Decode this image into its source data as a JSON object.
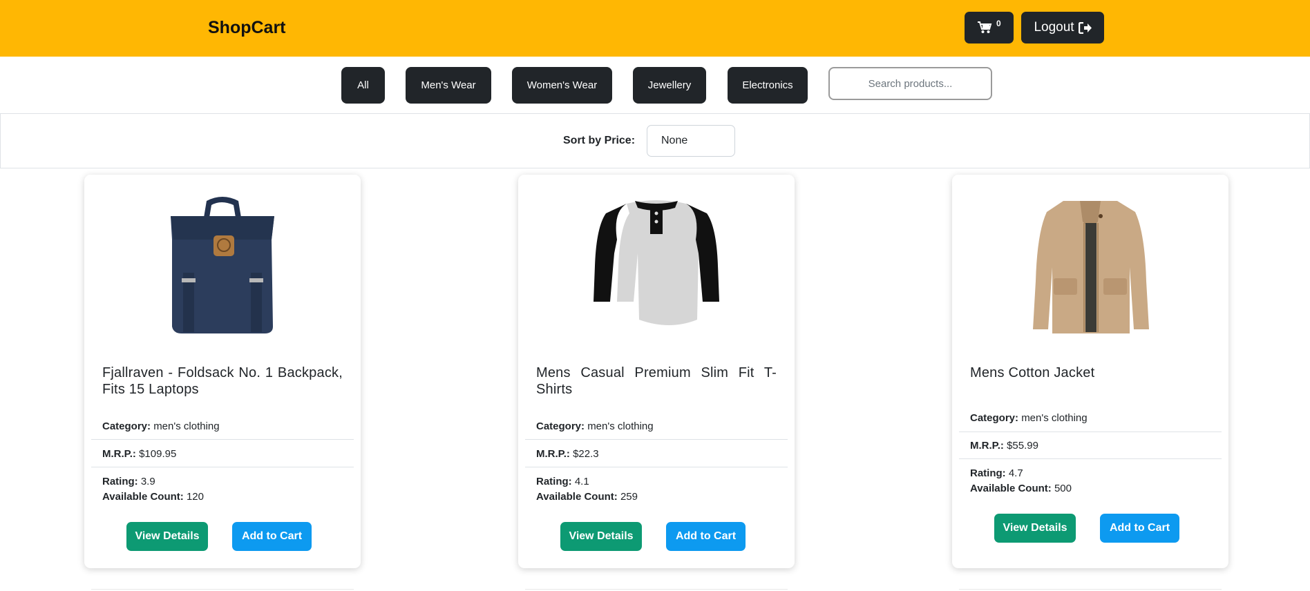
{
  "header": {
    "brand": "ShopCart",
    "cart_count": "0",
    "logout_label": "Logout",
    "cart_icon": "shopping-cart-icon",
    "logout_icon": "sign-out-icon",
    "bg_color": "#ffb703"
  },
  "filters": {
    "items": [
      {
        "label": "All"
      },
      {
        "label": "Men's Wear"
      },
      {
        "label": "Women's Wear"
      },
      {
        "label": "Jewellery"
      },
      {
        "label": "Electronics"
      }
    ],
    "search_placeholder": "Search products..."
  },
  "sort": {
    "label": "Sort by Price:",
    "selected": "None"
  },
  "labels": {
    "category": "Category:",
    "mrp": "M.R.P.:",
    "rating": "Rating:",
    "available": "Available Count:",
    "view_details": "View Details",
    "add_to_cart": "Add to Cart"
  },
  "products": [
    {
      "title": "Fjallraven - Foldsack No. 1 Backpack, Fits 15 Laptops",
      "category": "men's clothing",
      "mrp": "$109.95",
      "rating": "3.9",
      "available": "120",
      "image": "backpack-image"
    },
    {
      "title": "Mens Casual Premium Slim Fit T-Shirts",
      "category": "men's clothing",
      "mrp": "$22.3",
      "rating": "4.1",
      "available": "259",
      "image": "tshirt-image"
    },
    {
      "title": "Mens Cotton Jacket",
      "category": "men's clothing",
      "mrp": "$55.99",
      "rating": "4.7",
      "available": "500",
      "image": "jacket-image"
    }
  ]
}
